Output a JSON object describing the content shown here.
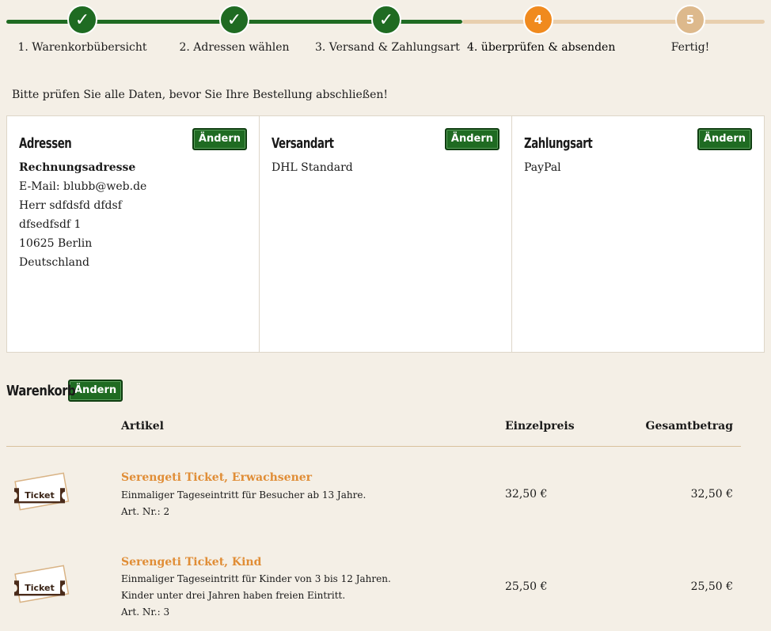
{
  "steps": [
    {
      "num": "✓",
      "label": "1. Warenkorbübersicht",
      "state": "done"
    },
    {
      "num": "✓",
      "label": "2. Adressen wählen",
      "state": "done"
    },
    {
      "num": "✓",
      "label": "3. Versand & Zahlungsart",
      "state": "done"
    },
    {
      "num": "4",
      "label": "4. überprüfen & absenden",
      "state": "current"
    },
    {
      "num": "5",
      "label": "Fertig!",
      "state": "todo"
    }
  ],
  "intro": "Bitte prüfen Sie alle Daten, bevor Sie Ihre Bestellung abschließen!",
  "edit_label": "Ändern",
  "addresses": {
    "title": "Adressen",
    "subtitle": "Rechnungsadresse",
    "lines": [
      "E-Mail: blubb@web.de",
      "Herr sdfdsfd dfdsf",
      "dfsedfsdf 1",
      "10625 Berlin",
      "Deutschland"
    ]
  },
  "shipping": {
    "title": "Versandart",
    "value": "DHL Standard"
  },
  "payment": {
    "title": "Zahlungsart",
    "value": "PayPal"
  },
  "cart": {
    "title": "Warenkorb",
    "headers": {
      "article": "Artikel",
      "unit_price": "Einzelpreis",
      "total": "Gesamtbetrag"
    },
    "items": [
      {
        "ticket_text": "Ticket",
        "title": "Serengeti Ticket, Erwachsener",
        "desc": [
          "Einmaliger Tageseintritt für Besucher ab 13 Jahre."
        ],
        "art_nr": "Art. Nr.: 2",
        "unit_price": "32,50 €",
        "total": "32,50 €"
      },
      {
        "ticket_text": "Ticket",
        "title": "Serengeti Ticket, Kind",
        "desc": [
          "Einmaliger Tageseintritt für Kinder von 3 bis 12 Jahren.",
          "Kinder unter drei Jahren haben freien Eintritt."
        ],
        "art_nr": "Art. Nr.: 3",
        "unit_price": "25,50 €",
        "total": "25,50 €"
      }
    ]
  },
  "colors": {
    "primary_green": "#1f6b22",
    "accent_orange": "#f08a1e",
    "pending_tan": "#ddb98c",
    "title_orange": "#e08d36"
  }
}
